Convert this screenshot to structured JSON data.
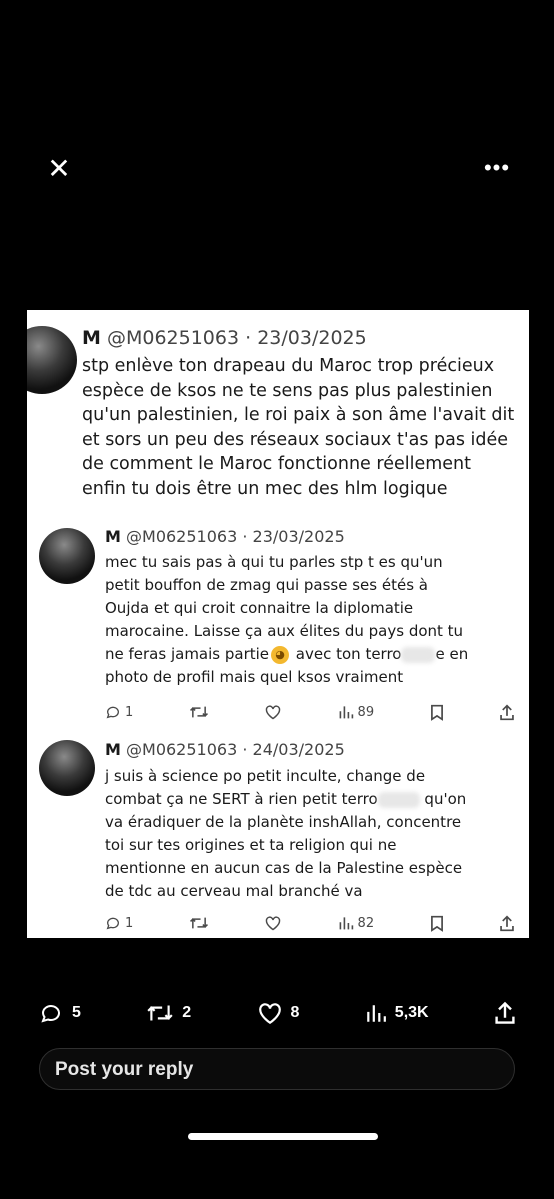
{
  "toolbar": {
    "close_symbol": "✕",
    "more_symbol": "•••"
  },
  "tweets": [
    {
      "name": "M",
      "handle": "@M06251063",
      "date": "· 23/03/2025",
      "text": "stp enlève ton drapeau du Maroc trop précieux\nespèce de ksos ne te sens pas plus palestinien\nqu'un palestinien, le roi paix à son âme l'avait dit\net sors un peu des réseaux sociaux t'as pas idée\nde comment le Maroc fonctionne réellement\nenfin tu dois être un mec des hlm logique"
    },
    {
      "name": "M",
      "handle": "@M06251063",
      "date": "· 23/03/2025",
      "text_before": "mec tu sais pas à qui tu parles stp t es qu'un\npetit bouffon de zmag qui passe ses étés à\nOujda et qui croit connaitre la diplomatie\nmarocaine. Laisse ça aux élites du pays dont tu\nne feras jamais partie",
      "text_after_emoji": " avec ton terro",
      "text_after_blur": "e en\nphoto de profil mais quel ksos vraiment",
      "replies": "1",
      "views": "89"
    },
    {
      "name": "M",
      "handle": "@M06251063",
      "date": "· 24/03/2025",
      "text_before": "j suis à science po petit inculte, change de\ncombat ça ne SERT à rien petit terro",
      "text_after_blur": " qu'on\nva éradiquer de la planète inshAllah, concentre\ntoi sur tes origines et ta religion qui ne\nmentionne en aucun cas de la Palestine espèce\nde tdc au cerveau mal branché va",
      "replies": "1",
      "views": "82"
    }
  ],
  "post_actions": {
    "replies": "5",
    "reposts": "2",
    "likes": "8",
    "views": "5,3K"
  },
  "reply": {
    "placeholder": "Post your reply"
  },
  "icons": [
    "close-icon",
    "more-icon",
    "reply-icon",
    "repost-icon",
    "like-icon",
    "views-icon",
    "bookmark-icon",
    "share-icon",
    "emoji-icon"
  ]
}
